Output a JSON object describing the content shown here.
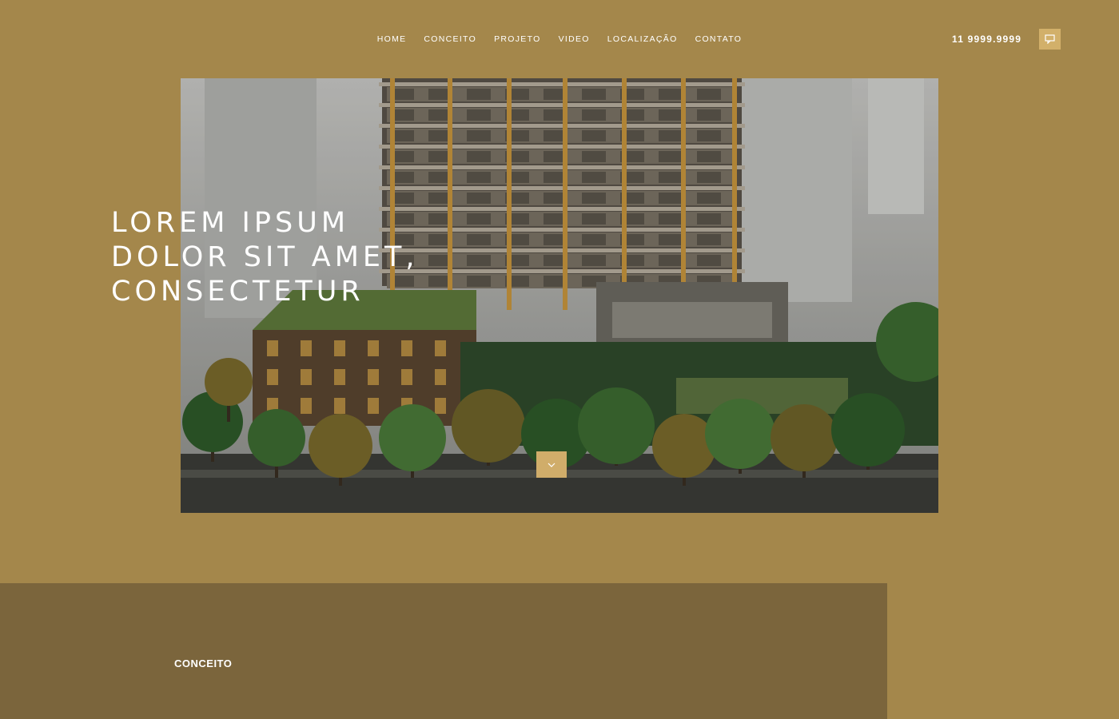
{
  "nav": {
    "items": [
      {
        "label": "HOME"
      },
      {
        "label": "CONCEITO"
      },
      {
        "label": "PROJETO"
      },
      {
        "label": "VIDEO"
      },
      {
        "label": "LOCALIZAÇÃO"
      },
      {
        "label": "CONTATO"
      }
    ]
  },
  "header": {
    "phone": "11 9999.9999",
    "chat_icon": "chat-bubble-icon"
  },
  "hero": {
    "headline": [
      "LOREM IPSUM",
      "DOLOR SIT AMET,",
      "CONSECTETUR"
    ],
    "image": "building-rendering",
    "scroll_icon": "chevron-down-icon"
  },
  "section": {
    "title": "CONCEITO"
  },
  "colors": {
    "background": "#a4874b",
    "section_background": "#7b653c",
    "accent": "#d0ad6a",
    "text": "#ffffff"
  }
}
